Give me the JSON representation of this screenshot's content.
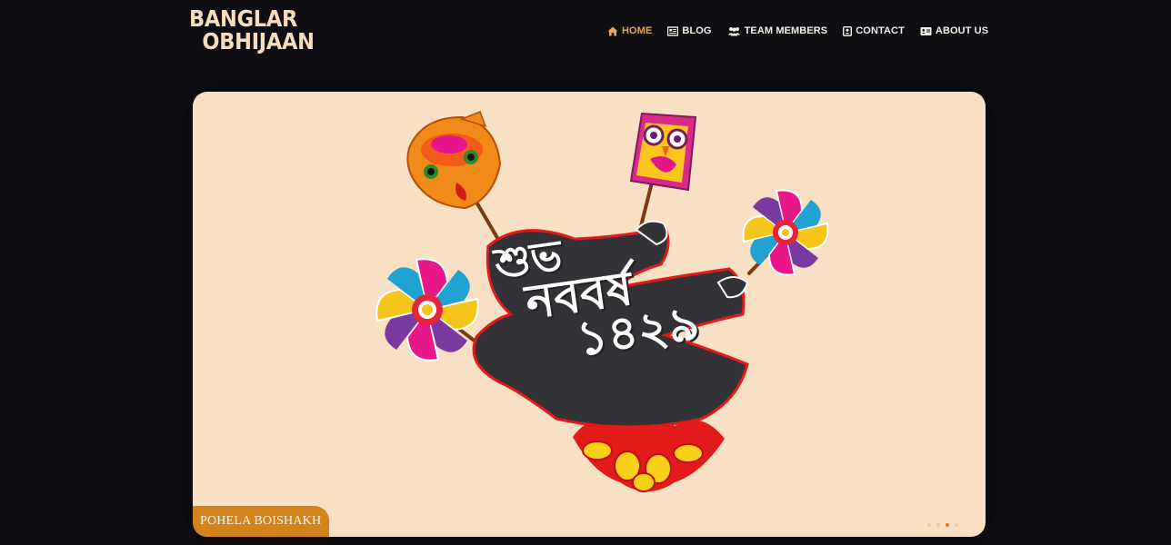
{
  "brand": {
    "line1": "BANGLAR",
    "line2": "OBHIJAAN"
  },
  "nav": [
    {
      "label": "HOME",
      "icon": "home-icon",
      "active": true
    },
    {
      "label": "BLOG",
      "icon": "blog-icon",
      "active": false
    },
    {
      "label": "TEAM MEMBERS",
      "icon": "team-icon",
      "active": false
    },
    {
      "label": "CONTACT",
      "icon": "contact-icon",
      "active": false
    },
    {
      "label": "ABOUT US",
      "icon": "about-icon",
      "active": false
    }
  ],
  "slider": {
    "heading_line1": "শুভ",
    "heading_line2": "নববর্ষ",
    "year": "১৪২৯",
    "caption": "POHELA BOISHAKH",
    "slide_count": 4,
    "active_slide": 2
  },
  "colors": {
    "background": "#0f0e12",
    "accent": "#e0a860",
    "banner_bg": "#f8e0c4",
    "caption_bg": "#d2831a"
  }
}
